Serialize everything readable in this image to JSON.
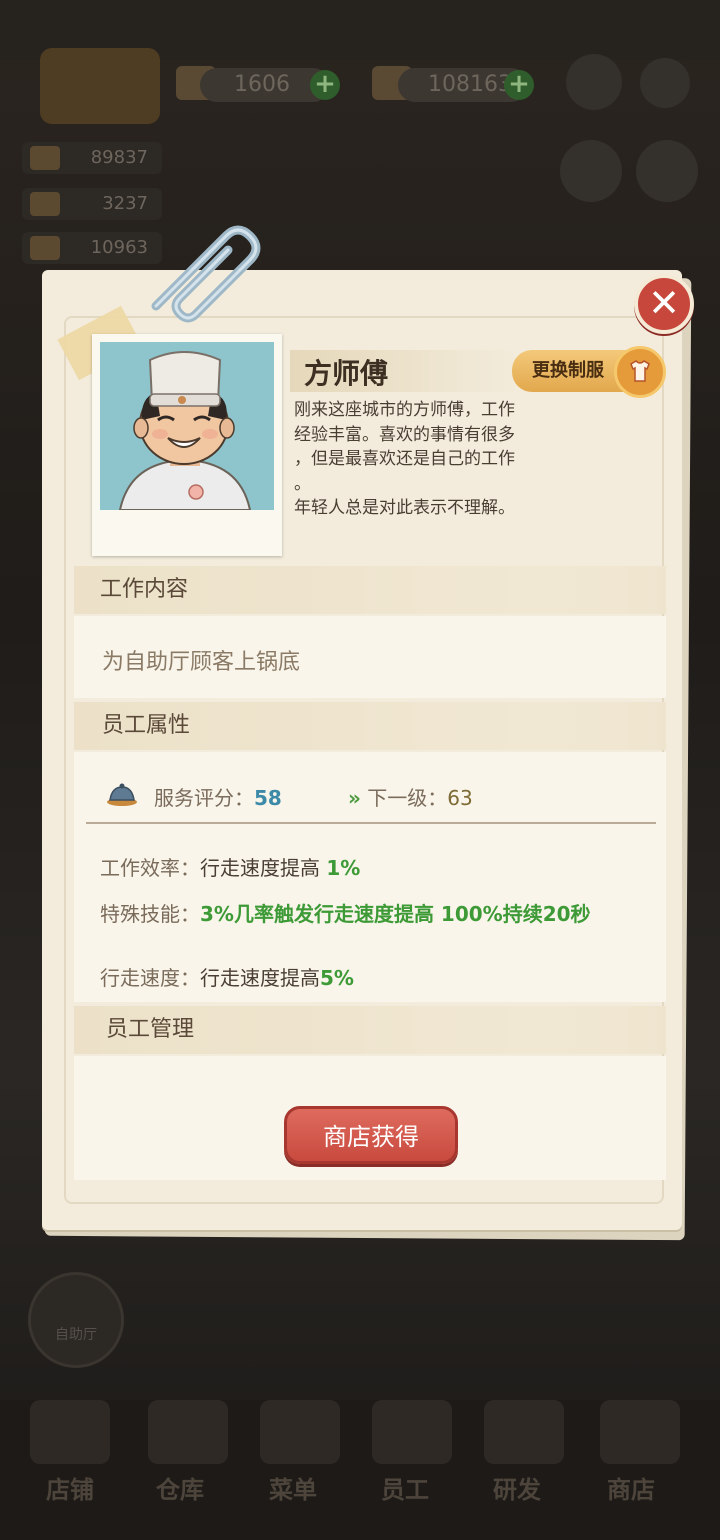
{
  "background": {
    "currency_gold": "1606",
    "currency_cash": "108163",
    "stats": [
      "89837",
      "3237",
      "10963"
    ],
    "buffet_button_label": "自助厅",
    "bottom_nav": [
      "店铺",
      "仓库",
      "菜单",
      "员工",
      "研发",
      "商店"
    ]
  },
  "dialog": {
    "close_symbol": "✕",
    "staff_name": "方师傅",
    "change_uniform_label": "更换制服",
    "bio": "刚来这座城市的方师傅，工作\n经验丰富。喜欢的事情有很多\n，但是最喜欢还是自己的工作\n。\n年轻人总是对此表示不理解。",
    "sections": {
      "job": {
        "title": "工作内容",
        "content": "为自助厅顾客上锅底"
      },
      "attributes": {
        "title": "员工属性",
        "service_rating_label": "服务评分：",
        "service_rating_value": "58",
        "next_level_label": "下一级：",
        "next_level_value": "63",
        "efficiency_label": "工作效率：",
        "efficiency_text": "行走速度提高",
        "efficiency_value": "1%",
        "skill_label": "特殊技能：",
        "skill_text": "3%几率触发行走速度提高 100%持续20秒",
        "speed_label": "行走速度：",
        "speed_text": "行走速度提高",
        "speed_value": "5%"
      },
      "management": {
        "title": "员工管理",
        "shop_button_label": "商店获得"
      }
    }
  },
  "colors": {
    "accent_red": "#c94a3f",
    "accent_orange": "#e2a84d",
    "green_value": "#3d9a36",
    "blue_value": "#3c8aa8",
    "paper": "#f3ecdc"
  }
}
